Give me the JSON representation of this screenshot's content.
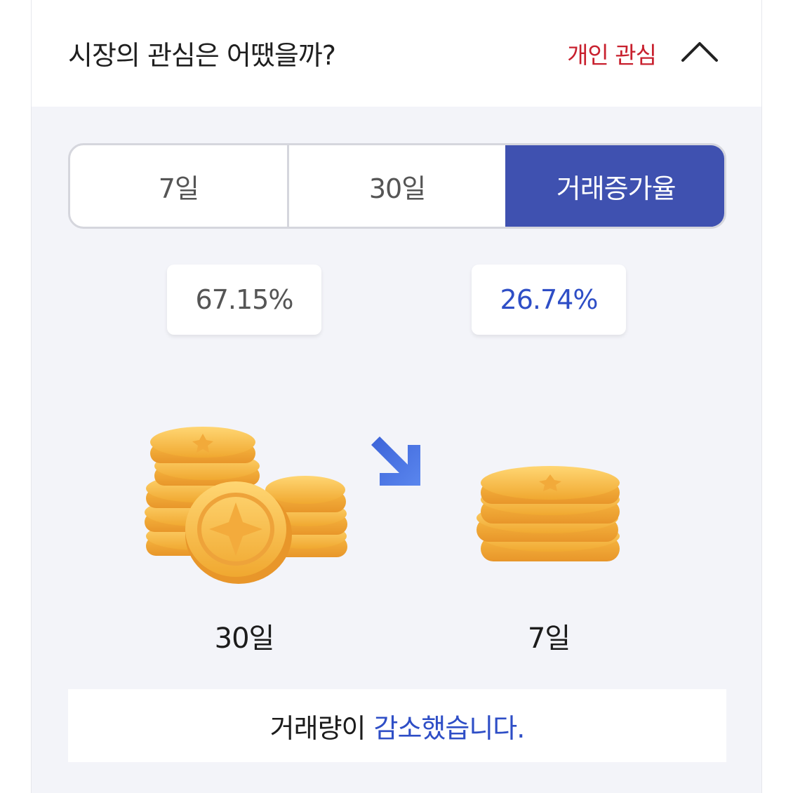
{
  "header": {
    "title": "시장의 관심은 어땠을까?",
    "tag": "개인 관심",
    "toggle_icon": "chevron-up-icon"
  },
  "tabs": [
    {
      "label": "7일",
      "active": false
    },
    {
      "label": "30일",
      "active": false
    },
    {
      "label": "거래증가율",
      "active": true
    }
  ],
  "comparison": {
    "left": {
      "percent": "67.15%",
      "label": "30일",
      "icon": "coin-stack-large-icon"
    },
    "right": {
      "percent": "26.74%",
      "label": "7일",
      "icon": "coin-stack-small-icon"
    },
    "arrow_icon": "arrow-down-right-icon"
  },
  "result": {
    "prefix": "거래량이",
    "highlight": "감소했습니다."
  },
  "colors": {
    "accent": "#3f51b0",
    "blue_text": "#2e4ec6",
    "red_tag": "#c8202e",
    "coin": "#f5b942"
  }
}
